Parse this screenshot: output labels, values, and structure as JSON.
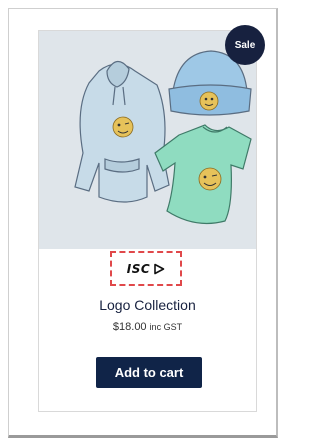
{
  "badge": {
    "label": "Sale"
  },
  "brand": {
    "text": "ISC"
  },
  "product": {
    "title": "Logo Collection",
    "price": "$18.00",
    "price_suffix": "inc GST"
  },
  "actions": {
    "add_to_cart_label": "Add to cart"
  },
  "colors": {
    "badge": "#17213f",
    "button": "#102448",
    "title": "#17213f",
    "logo_border": "#e0484a",
    "image_bg": "#dfe5ea"
  },
  "icons": {
    "brand_arrow": "play-arrow-outline-icon"
  }
}
